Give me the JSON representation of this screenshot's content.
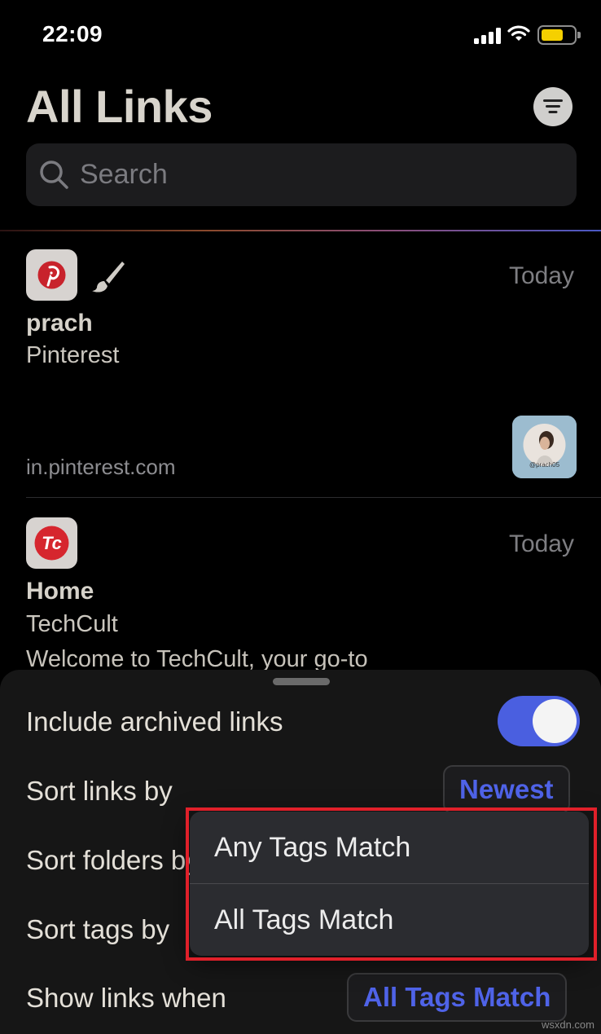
{
  "status_bar": {
    "time": "22:09"
  },
  "header": {
    "title": "All Links"
  },
  "search": {
    "placeholder": "Search"
  },
  "links": [
    {
      "title": "prach",
      "site": "Pinterest",
      "date": "Today",
      "domain": "in.pinterest.com",
      "thumbnail_caption": "@prach05",
      "icon": "pinterest-icon"
    },
    {
      "title": "Home",
      "site": "TechCult",
      "date": "Today",
      "description": "Welcome to TechCult, your go-to",
      "icon": "techcult-icon",
      "icon_text": "Tc"
    }
  ],
  "settings": {
    "include_archived": {
      "label": "Include archived links",
      "enabled": true
    },
    "sort_links": {
      "label": "Sort links by",
      "value": "Newest"
    },
    "sort_folders": {
      "label": "Sort folders by"
    },
    "sort_tags": {
      "label": "Sort tags by"
    },
    "show_links_when": {
      "label": "Show links when",
      "value": "All Tags Match"
    }
  },
  "popup_menu": {
    "options": [
      "Any Tags Match",
      "All Tags Match"
    ]
  },
  "watermark": "wsxdn.com",
  "colors": {
    "accent": "#4a5fe0",
    "highlight": "#e0202a",
    "pinterest": "#c8232c",
    "techcult": "#d6262e"
  }
}
